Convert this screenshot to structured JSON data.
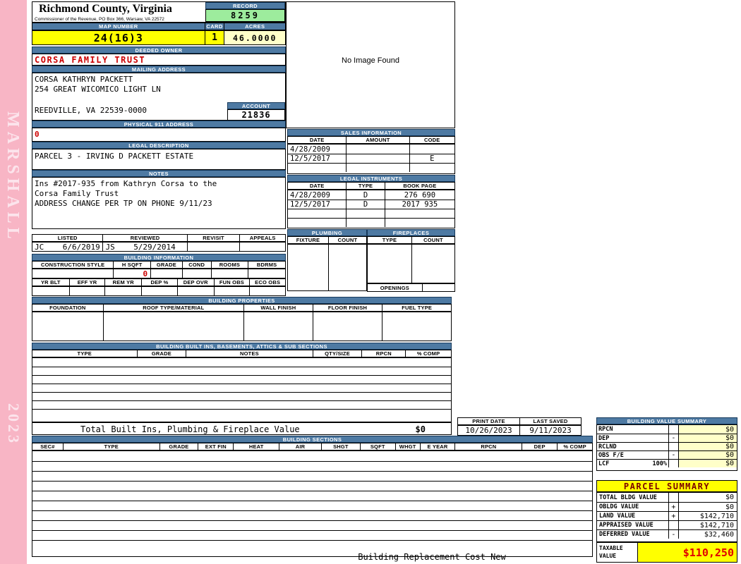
{
  "sidebar": {
    "brand": "MARSHALL",
    "year": "2023"
  },
  "header": {
    "county": "Richmond County, Virginia",
    "office": "Commissioner of the Revenue, PO Box 366, Warsaw, VA 22572",
    "record_label": "RECORD",
    "record_value": "8259",
    "map_label": "MAP NUMBER",
    "map_value": "24(16)3",
    "card_label": "CARD",
    "card_value": "1",
    "acres_label": "ACRES",
    "acres_value": "46.0000"
  },
  "owner": {
    "label": "DEEDED OWNER",
    "name": "CORSA FAMILY TRUST"
  },
  "mailing": {
    "label": "MAILING ADDRESS",
    "line1": "CORSA KATHRYN PACKETT",
    "line2": "254 GREAT WICOMICO LIGHT LN",
    "line3": "REEDVILLE, VA 22539-0000",
    "account_label": "ACCOUNT",
    "account_value": "21836"
  },
  "physical": {
    "label": "PHYSICAL 911 ADDRESS",
    "value": "0"
  },
  "legal_description": {
    "label": "LEGAL DESCRIPTION",
    "value": "PARCEL 3 - IRVING D PACKETT ESTATE"
  },
  "notes": {
    "label": "NOTES",
    "line1": "Ins #2017-935 from Kathryn Corsa to the",
    "line2": "Corsa Family Trust",
    "line3": "ADDRESS CHANGE PER TP ON PHONE 9/11/23"
  },
  "photo": {
    "placeholder": "No Image Found"
  },
  "sales": {
    "label": "SALES INFORMATION",
    "col_date": "DATE",
    "col_amount": "AMOUNT",
    "col_code": "CODE",
    "rows": [
      {
        "date": "4/28/2009",
        "amount": "",
        "code": ""
      },
      {
        "date": "12/5/2017",
        "amount": "",
        "code": "E"
      }
    ]
  },
  "instruments": {
    "label": "LEGAL INSTRUMENTS",
    "col_date": "DATE",
    "col_type": "TYPE",
    "col_book": "BOOK PAGE",
    "rows": [
      {
        "date": "4/28/2009",
        "type": "D",
        "book": "276 690"
      },
      {
        "date": "12/5/2017",
        "type": "D",
        "book": "2017 935"
      }
    ]
  },
  "plumbing": {
    "label": "PLUMBING",
    "col_fixture": "FIXTURE",
    "col_count": "COUNT"
  },
  "fireplaces": {
    "label": "FIREPLACES",
    "col_type": "TYPE",
    "col_count": "COUNT",
    "openings": "OPENINGS"
  },
  "inspection": {
    "col_listed": "LISTED",
    "col_reviewed": "REVIEWED",
    "col_revisit": "REVISIT",
    "col_appeals": "APPEALS",
    "listed": "JC    6/6/2019",
    "reviewed": "JS    5/29/2014"
  },
  "building_info": {
    "label": "BUILDING INFORMATION",
    "cols1": [
      "CONSTRUCTION STYLE",
      "H SQFT",
      "GRADE",
      "COND",
      "ROOMS",
      "BDRMS"
    ],
    "h_sqft_value": "0",
    "cols2": [
      "YR BLT",
      "EFF YR",
      "REM YR",
      "DEP %",
      "DEP OVR",
      "FUN OBS",
      "ECO OBS"
    ]
  },
  "building_properties": {
    "label": "BUILDING PROPERTIES",
    "cols": [
      "FOUNDATION",
      "ROOF TYPE/MATERIAL",
      "WALL FINISH",
      "FLOOR FINISH",
      "FUEL TYPE"
    ]
  },
  "built_ins": {
    "label": "BUILDING BUILT INS, BASEMENTS, ATTICS & SUB SECTIONS",
    "cols": [
      "TYPE",
      "GRADE",
      "NOTES",
      "QTY/SIZE",
      "RPCN",
      "% COMP"
    ],
    "total_label": "Total Built Ins, Plumbing & Fireplace Value",
    "total_value": "$0"
  },
  "print_info": {
    "print_date_label": "PRINT DATE",
    "print_date": "10/26/2023",
    "last_saved_label": "LAST SAVED",
    "last_saved": "9/11/2023"
  },
  "building_value_summary": {
    "label": "BUILDING VALUE SUMMARY",
    "rows": [
      {
        "name": "RPCN",
        "extra": "",
        "op": "",
        "value": "$0"
      },
      {
        "name": "DEP",
        "extra": "",
        "op": "-",
        "value": "$0"
      },
      {
        "name": "RCLND",
        "extra": "",
        "op": "",
        "value": "$0"
      },
      {
        "name": "OBS F/E",
        "extra": "",
        "op": "-",
        "value": "$0"
      },
      {
        "name": "LCF",
        "extra": "100%",
        "op": "",
        "value": "$0"
      }
    ]
  },
  "building_sections": {
    "label": "BUILDING SECTIONS",
    "cols": [
      "SEC#",
      "TYPE",
      "GRADE",
      "EXT FIN",
      "HEAT",
      "AIR",
      "SHGT",
      "SQFT",
      "WHGT",
      "E YEAR",
      "RPCN",
      "DEP",
      "% COMP"
    ]
  },
  "parcel_summary": {
    "label": "PARCEL SUMMARY",
    "rows": [
      {
        "name": "TOTAL BLDG VALUE",
        "op": "",
        "value": "$0"
      },
      {
        "name": "OBLDG VALUE",
        "op": "+",
        "value": "$0"
      },
      {
        "name": "LAND VALUE",
        "op": "+",
        "value": "$142,710"
      },
      {
        "name": "APPRAISED VALUE",
        "op": "",
        "value": "$142,710"
      },
      {
        "name": "DEFERRED VALUE",
        "op": "-",
        "value": "$32,460"
      }
    ],
    "taxable_label_1": "TAXABLE",
    "taxable_label_2": "VALUE",
    "taxable_value": "$110,250"
  },
  "footer": {
    "text": "Building Replacement Cost New"
  },
  "colors": {
    "header_bar": "#4e7aa3",
    "record_green": "#9dec9d",
    "highlight_yellow": "#ffff00",
    "pale_yellow": "#ffffc9",
    "sidebar_pink": "#f8b5c5",
    "value_red": "#cc0000",
    "taxable_red": "#e00000"
  }
}
